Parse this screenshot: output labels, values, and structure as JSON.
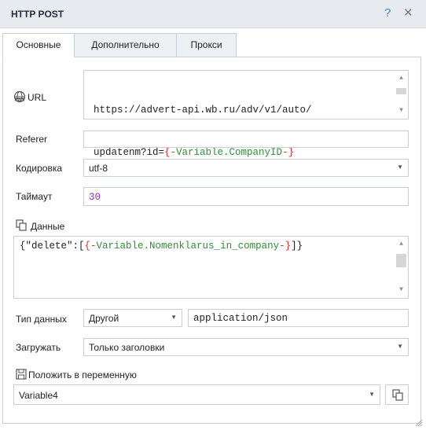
{
  "window": {
    "title": "HTTP POST",
    "help": "?",
    "close": "✕"
  },
  "tabs": [
    {
      "label": "Основные",
      "active": true
    },
    {
      "label": "Дополнительно",
      "active": false
    },
    {
      "label": "Прокси",
      "active": false
    }
  ],
  "url": {
    "label": "URL",
    "line1": "https://advert-api.wb.ru/adv/v1/auto/",
    "line2_prefix": "updatenm?id=",
    "var_open": "{-",
    "var_kw": "Variable",
    "var_name": ".CompanyID",
    "var_close": "-}"
  },
  "referer": {
    "label": "Referer",
    "value": ""
  },
  "encoding": {
    "label": "Кодировка",
    "value": "utf-8"
  },
  "timeout": {
    "label": "Таймаут",
    "value": "30"
  },
  "data": {
    "label": "Данные",
    "open": "{\"delete\":[",
    "var_open": "{-",
    "var_kw": "Variable",
    "var_name": ".Nomenklarus_in_company",
    "var_close": "-}",
    "close": "]}"
  },
  "data_type": {
    "label": "Тип данных",
    "select": "Другой",
    "content_type": "application/json"
  },
  "load": {
    "label": "Загружать",
    "value": "Только заголовки"
  },
  "save_to": {
    "label": "Положить в переменную",
    "value": "Variable4"
  },
  "icons": {
    "url": "globe-icon",
    "data": "copy-icon",
    "save": "save-icon",
    "copy_btn": "copy-icon"
  },
  "colors": {
    "variable_brace": "#d23030",
    "variable_name": "#2f8f37",
    "number": "#8a2fb5",
    "accent": "#3c8fd6"
  }
}
